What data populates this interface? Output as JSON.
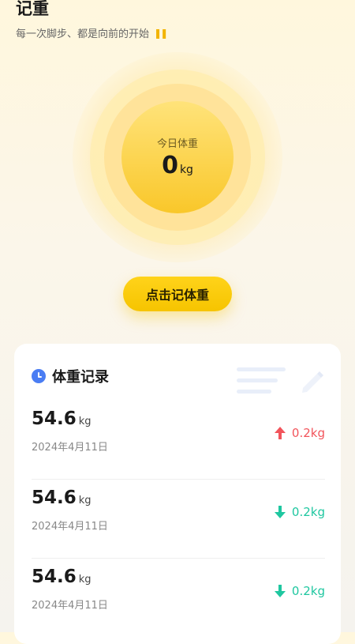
{
  "header": {
    "title": "记重",
    "subtitle": "每一次脚步、都是向前的开始",
    "subtitle_icon": "footprints-icon"
  },
  "today": {
    "label": "今日体重",
    "value": "0",
    "unit": "kg"
  },
  "record_button": "点击记体重",
  "records": {
    "title": "体重记录",
    "icon": "clock-icon",
    "items": [
      {
        "value": "54.6",
        "unit": "kg",
        "date": "2024年4月11日",
        "direction": "up",
        "change": "0.2kg",
        "color": "#F2545B"
      },
      {
        "value": "54.6",
        "unit": "kg",
        "date": "2024年4月11日",
        "direction": "down",
        "change": "0.2kg",
        "color": "#1FC7A0"
      },
      {
        "value": "54.6",
        "unit": "kg",
        "date": "2024年4月11日",
        "direction": "down",
        "change": "0.2kg",
        "color": "#1FC7A0"
      }
    ]
  },
  "colors": {
    "accent_yellow": "#F6C400",
    "up_red": "#F2545B",
    "down_green": "#1FC7A0",
    "clock_blue": "#4A7DF3"
  }
}
